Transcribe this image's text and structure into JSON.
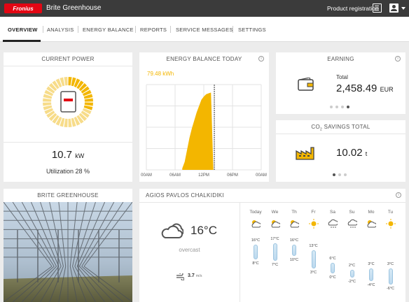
{
  "header": {
    "logo_text": "Fronius",
    "site_title": "Brite Greenhouse",
    "product_registration": "Product registration"
  },
  "nav": {
    "tabs": [
      "OVERVIEW",
      "ANALYSIS",
      "ENERGY BALANCE",
      "REPORTS",
      "SERVICE MESSAGES",
      "SETTINGS"
    ]
  },
  "current_power": {
    "title": "CURRENT POWER",
    "value": "10.7",
    "unit": "kW",
    "utilization": "Utilization 28 %",
    "utilization_fraction": 0.28
  },
  "energy_balance": {
    "title": "ENERGY BALANCE TODAY",
    "total": "79.48 kWh",
    "info": "i"
  },
  "chart_data": {
    "type": "area",
    "x_ticks": [
      "00AM",
      "06AM",
      "12PM",
      "06PM",
      "00AM"
    ],
    "series": [
      {
        "values_x_hours": [
          7.5,
          8,
          8.5,
          9,
          9.5,
          10,
          10.5,
          11,
          11.5,
          12,
          12.5,
          13,
          13.5,
          14
        ],
        "values_rel": [
          0.02,
          0.1,
          0.25,
          0.4,
          0.52,
          0.62,
          0.72,
          0.8,
          0.88,
          0.92,
          0.95,
          0.96,
          0.97,
          0
        ]
      }
    ],
    "color": "#f3b600",
    "now_marker_hours": 14.2
  },
  "earning": {
    "title": "EARNING",
    "label": "Total",
    "value": "2,458.49",
    "unit": "EUR",
    "info": "i"
  },
  "co2": {
    "title_prefix": "CO",
    "title_sub": "2",
    "title_suffix": " SAVINGS TOTAL",
    "value": "10.02",
    "unit": "t"
  },
  "greenhouse": {
    "title": "BRITE GREENHOUSE"
  },
  "weather": {
    "title": "AGIOS PAVLOS CHALKIDIKI",
    "info": "i",
    "current_temp": "16°C",
    "condition": "overcast",
    "wind_value": "3.7",
    "wind_unit": "m/s",
    "forecast": [
      {
        "day": "Today",
        "high": "16°C",
        "low": "8°C",
        "icon": "partly-cloudy-icon",
        "hi": 16,
        "lo": 8
      },
      {
        "day": "We",
        "high": "17°C",
        "low": "7°C",
        "icon": "partly-cloudy-icon",
        "hi": 17,
        "lo": 7
      },
      {
        "day": "Th",
        "high": "16°C",
        "low": "10°C",
        "icon": "partly-cloudy-icon",
        "hi": 16,
        "lo": 10
      },
      {
        "day": "Fr",
        "high": "13°C",
        "low": "3°C",
        "icon": "sunny-icon",
        "hi": 13,
        "lo": 3
      },
      {
        "day": "Sa",
        "high": "6°C",
        "low": "0°C",
        "icon": "snow-cloud-icon",
        "hi": 6,
        "lo": 0
      },
      {
        "day": "Su",
        "high": "2°C",
        "low": "-2°C",
        "icon": "snow-cloud-icon",
        "hi": 2,
        "lo": -2
      },
      {
        "day": "Mo",
        "high": "3°C",
        "low": "-4°C",
        "icon": "partly-cloudy-icon",
        "hi": 3,
        "lo": -4
      },
      {
        "day": "Tu",
        "high": "3°C",
        "low": "-6°C",
        "icon": "sunny-icon",
        "hi": 3,
        "lo": -6
      }
    ]
  }
}
